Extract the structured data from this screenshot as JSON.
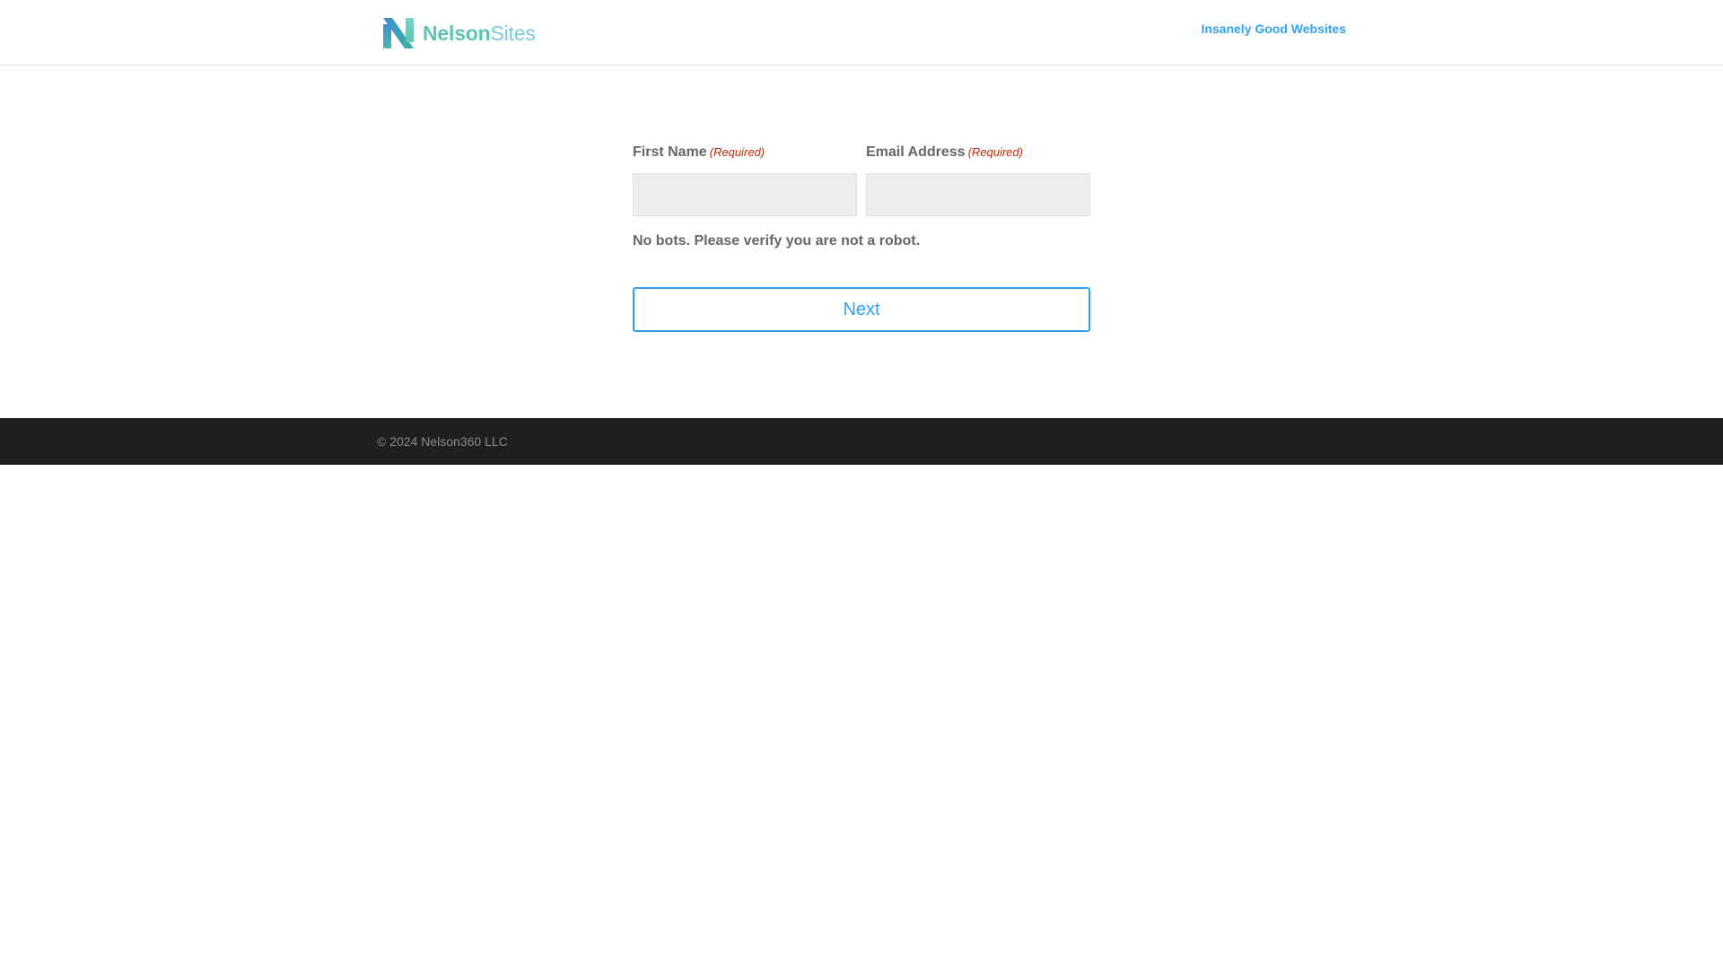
{
  "header": {
    "logo": {
      "word1": "Nelson",
      "word2": "Sites"
    },
    "nav_link": "Insanely Good Websites"
  },
  "form": {
    "first_name": {
      "label": "First Name",
      "required": "(Required)",
      "value": "",
      "placeholder": ""
    },
    "email": {
      "label": "Email Address",
      "required": "(Required)",
      "value": "",
      "placeholder": ""
    },
    "captcha_text": "No bots. Please verify you are not a robot.",
    "next_label": "Next"
  },
  "footer": {
    "copyright": "© 2024 Nelson360 LLC"
  },
  "colors": {
    "accent": "#2ea3f2",
    "required": "#c02b0a",
    "footer_bg": "#1f1f1f",
    "logo_teal": "#5fc3b3",
    "logo_blue": "#7ac9de"
  },
  "icons": {
    "logo": "nelson-n-logo-icon"
  }
}
